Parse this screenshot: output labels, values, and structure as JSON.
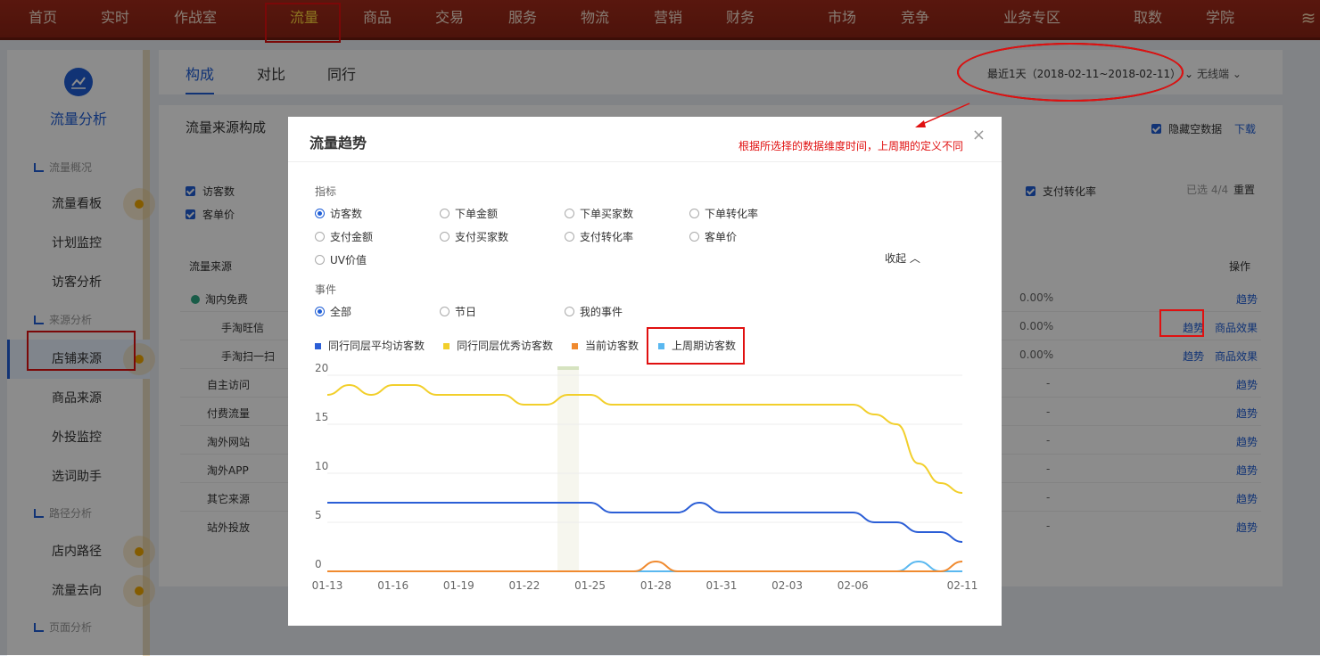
{
  "topnav": {
    "items": [
      "首页",
      "实时",
      "作战室",
      "流量",
      "商品",
      "交易",
      "服务",
      "物流",
      "营销",
      "财务",
      "市场",
      "竞争",
      "业务专区",
      "取数",
      "学院"
    ],
    "active": "流量",
    "corner_glyph": "≋"
  },
  "sidebar": {
    "title": "流量分析",
    "groups": [
      "流量概况",
      "来源分析",
      "路径分析",
      "页面分析"
    ],
    "items": [
      "流量看板",
      "计划监控",
      "访客分析",
      "店铺来源",
      "商品来源",
      "外投监控",
      "选词助手",
      "店内路径",
      "流量去向"
    ],
    "active": "店铺来源"
  },
  "tabs": {
    "items": [
      "构成",
      "对比",
      "同行"
    ],
    "active": "构成",
    "date_range": "最近1天（2018-02-11~2018-02-11）",
    "device": "无线端"
  },
  "panel": {
    "title": "流量来源构成",
    "hide_empty_label": "隐藏空数据",
    "download_label": "下载",
    "metrics_left": [
      "访客数",
      "客单价"
    ],
    "metric_right": "支付转化率",
    "selected_count": "已选 4/4",
    "reset_label": "重置",
    "col_source": "流量来源",
    "col_ops": "操作",
    "rows": [
      {
        "name": "淘内免费",
        "pct": "0.00%",
        "ops": [
          "趋势"
        ]
      },
      {
        "name": "手淘旺信",
        "pct": "0.00%",
        "ops": [
          "趋势",
          "商品效果"
        ]
      },
      {
        "name": "手淘扫一扫",
        "pct": "0.00%",
        "ops": [
          "趋势",
          "商品效果"
        ]
      },
      {
        "name": "自主访问",
        "pct": "-",
        "ops": [
          "趋势"
        ]
      },
      {
        "name": "付费流量",
        "pct": "-",
        "ops": [
          "趋势"
        ]
      },
      {
        "name": "淘外网站",
        "pct": "-",
        "ops": [
          "趋势"
        ]
      },
      {
        "name": "淘外APP",
        "pct": "-",
        "ops": [
          "趋势"
        ]
      },
      {
        "name": "其它来源",
        "pct": "-",
        "ops": [
          "趋势"
        ]
      },
      {
        "name": "站外投放",
        "pct": "-",
        "ops": [
          "趋势"
        ]
      }
    ]
  },
  "modal": {
    "title": "流量趋势",
    "close": "×",
    "annotation": "根据所选择的数据维度时间，上周期的定义不同",
    "metrics_label": "指标",
    "metrics": [
      "访客数",
      "下单金额",
      "下单买家数",
      "下单转化率",
      "支付金额",
      "支付买家数",
      "支付转化率",
      "客单价",
      "UV价值"
    ],
    "metric_selected": "访客数",
    "collapse_label": "收起",
    "events_label": "事件",
    "events": [
      "全部",
      "节日",
      "我的事件"
    ],
    "event_selected": "全部"
  },
  "colors": {
    "accent": "#1f5ed6",
    "peer_avg": "#2b5ed6",
    "peer_excellent": "#f2cf2b",
    "current": "#f08a2f",
    "previous": "#5ab8f0",
    "highlight": "#e01010"
  },
  "chart_data": {
    "type": "line",
    "x": [
      "01-13",
      "01-14",
      "01-15",
      "01-16",
      "01-17",
      "01-18",
      "01-19",
      "01-20",
      "01-21",
      "01-22",
      "01-23",
      "01-24",
      "01-25",
      "01-26",
      "01-27",
      "01-28",
      "01-29",
      "01-30",
      "01-31",
      "02-01",
      "02-02",
      "02-03",
      "02-04",
      "02-05",
      "02-06",
      "02-07",
      "02-08",
      "02-09",
      "02-10",
      "02-11"
    ],
    "xticks": [
      "01-13",
      "01-16",
      "01-19",
      "01-22",
      "01-25",
      "01-28",
      "01-31",
      "02-03",
      "02-06",
      "02-11"
    ],
    "ylim": [
      0,
      20
    ],
    "yticks": [
      0,
      5,
      10,
      15,
      20
    ],
    "grid": true,
    "legend_position": "top-left",
    "series": [
      {
        "name": "同行同层平均访客数",
        "color": "#2b5ed6",
        "values": [
          7,
          7,
          7,
          7,
          7,
          7,
          7,
          7,
          7,
          7,
          7,
          7,
          7,
          6,
          6,
          6,
          6,
          7,
          6,
          6,
          6,
          6,
          6,
          6,
          6,
          5,
          5,
          4,
          4,
          3
        ]
      },
      {
        "name": "同行同层优秀访客数",
        "color": "#f2cf2b",
        "values": [
          18,
          19,
          18,
          19,
          19,
          18,
          18,
          18,
          18,
          17,
          17,
          18,
          18,
          17,
          17,
          17,
          17,
          17,
          17,
          17,
          17,
          17,
          17,
          17,
          17,
          16,
          15,
          11,
          9,
          8
        ]
      },
      {
        "name": "当前访客数",
        "color": "#f08a2f",
        "values": [
          0,
          0,
          0,
          0,
          0,
          0,
          0,
          0,
          0,
          0,
          0,
          0,
          0,
          0,
          0,
          1,
          0,
          0,
          0,
          0,
          0,
          0,
          0,
          0,
          0,
          0,
          0,
          0,
          0,
          1
        ]
      },
      {
        "name": "上周期访客数",
        "color": "#5ab8f0",
        "values": [
          0,
          0,
          0,
          0,
          0,
          0,
          0,
          0,
          0,
          0,
          0,
          0,
          0,
          0,
          0,
          0,
          0,
          0,
          0,
          0,
          0,
          0,
          0,
          0,
          0,
          0,
          0,
          1,
          0,
          0
        ]
      }
    ]
  }
}
